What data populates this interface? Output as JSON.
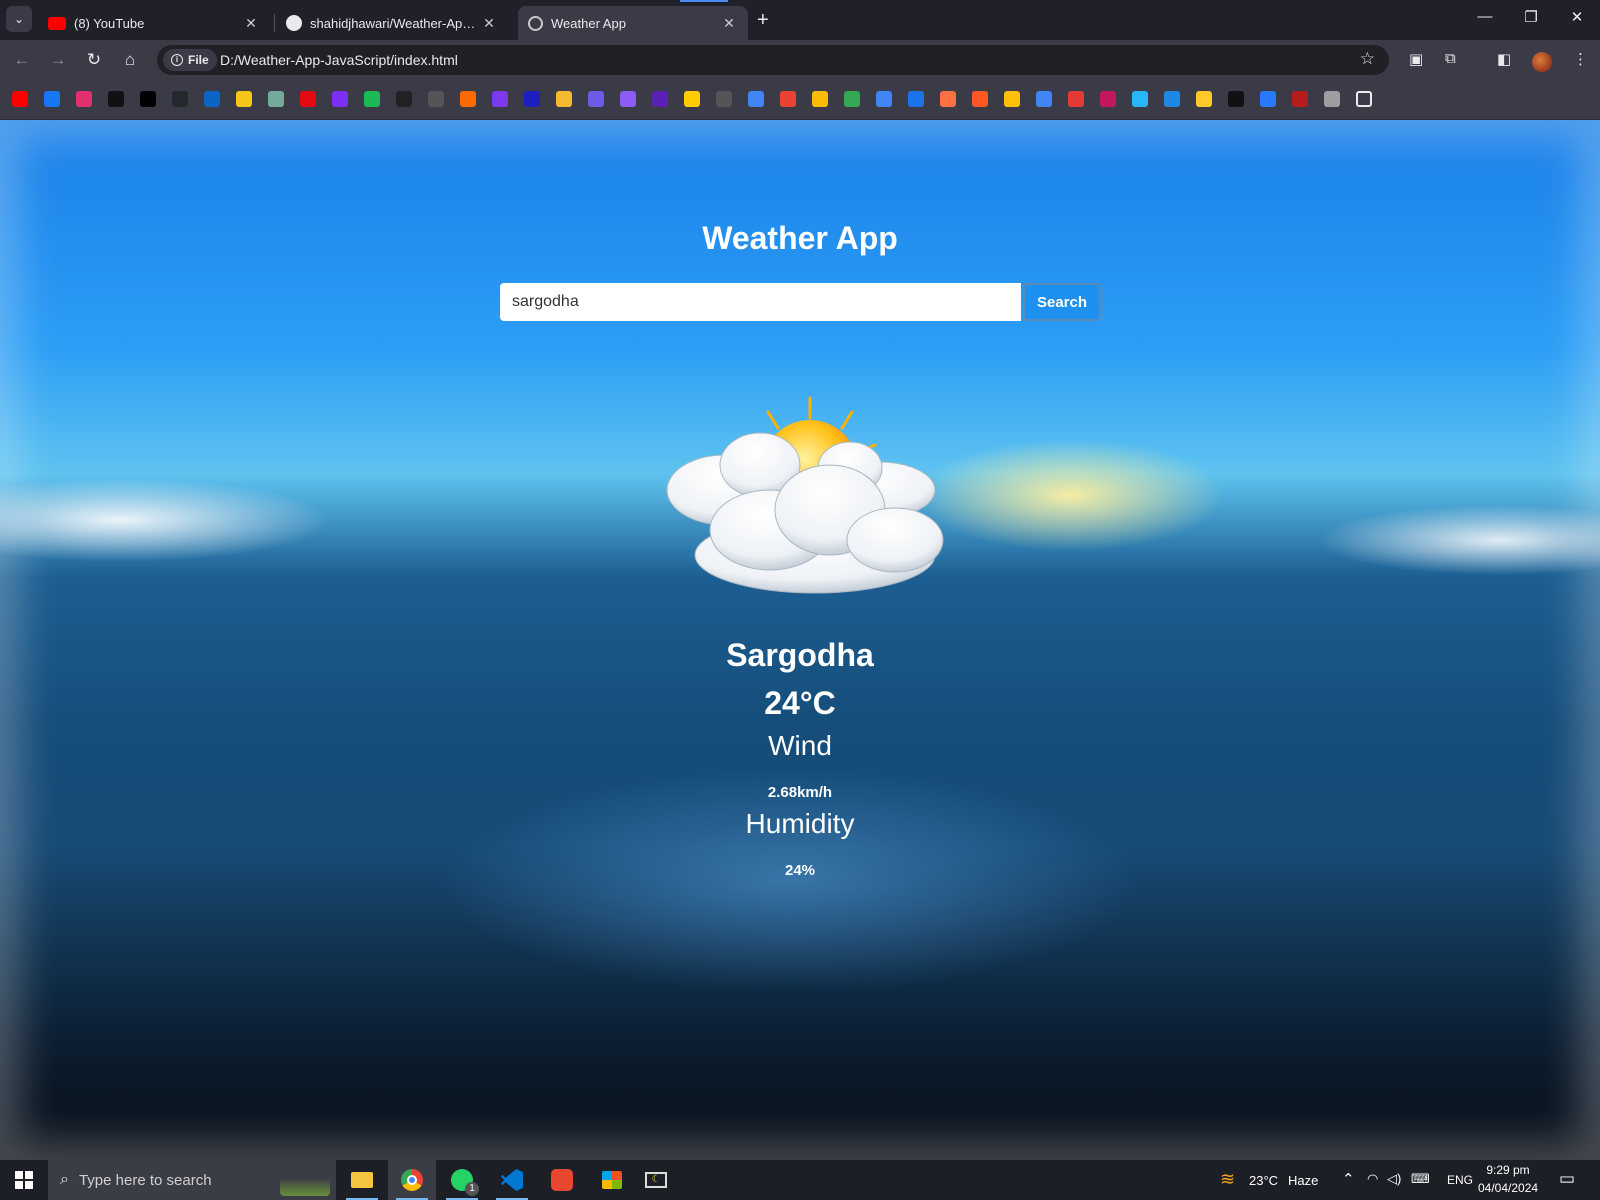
{
  "browser": {
    "tabs": [
      {
        "title": "(8) YouTube",
        "active": false
      },
      {
        "title": "shahidjhawari/Weather-App-JavaScript",
        "active": false
      },
      {
        "title": "Weather App",
        "active": true
      }
    ],
    "new_tab": "+",
    "window_controls": {
      "minimize": "—",
      "restore": "❐",
      "close": "✕"
    },
    "address": {
      "chip_label": "File",
      "url": "D:/Weather-App-JavaScript/index.html"
    },
    "bookmark_colors": [
      "#ff0000",
      "#1877f2",
      "#e1306c",
      "#111111",
      "#000000",
      "#24292e",
      "#0a66c2",
      "#f5c518",
      "#74aa9c",
      "#e50914",
      "#7b2ff7",
      "#1db954",
      "#222222",
      "#555555",
      "#ff6a00",
      "#7c3aed",
      "#1f1fbf",
      "#f3ba2f",
      "#6c5ce7",
      "#8b5cf6",
      "#5b21b6",
      "#ffcc00",
      "#555555",
      "#4285f4",
      "#ea4335",
      "#fbbc05",
      "#34a853",
      "#4285f4",
      "#1a73e8",
      "#ff7043",
      "#ff5722",
      "#ffc107",
      "#4285f4",
      "#e53935",
      "#c2185b",
      "#29b6f6",
      "#1e88e5",
      "#ffca28",
      "#111111",
      "#2979ff",
      "#b71c1c",
      "#9e9e9e"
    ]
  },
  "app": {
    "title": "Weather App",
    "search": {
      "value": "sargodha",
      "button": "Search"
    },
    "weather_icon": "sun-behind-clouds-icon",
    "city": "Sargodha",
    "temperature": "24°C",
    "wind": {
      "label": "Wind",
      "value": "2.68km/h"
    },
    "humidity": {
      "label": "Humidity",
      "value": "24%"
    }
  },
  "taskbar": {
    "search_placeholder": "Type here to search",
    "whatsapp_badge": "1",
    "weather": {
      "temp": "23°C",
      "condition": "Haze"
    },
    "language": "ENG",
    "time": "9:29 pm",
    "date": "04/04/2024"
  }
}
